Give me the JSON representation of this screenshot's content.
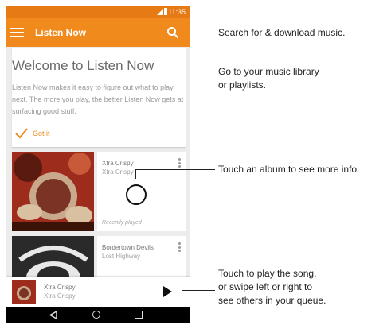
{
  "status_bar": {
    "time": "11:35"
  },
  "app_bar": {
    "title": "Listen Now",
    "menu_icon": "menu-icon",
    "search_icon": "search-icon"
  },
  "welcome_card": {
    "title": "Welcome to Listen Now",
    "body": "Listen Now makes it easy to figure out what to play next. The more you play, the better Listen Now gets at surfacing good stuff.",
    "got_it_label": "Got it",
    "got_it_icon": "check-icon"
  },
  "albums": [
    {
      "title": "Xtra Crispy",
      "artist": "Xtra Crispy",
      "note": "Recently played"
    },
    {
      "title": "Bordertown Devils",
      "artist": "Lost Highway",
      "note": ""
    }
  ],
  "now_playing": {
    "title": "Xtra Crispy",
    "artist": "Xtra Crispy",
    "play_icon": "play-icon"
  },
  "nav_bar": {
    "icons": [
      "back-icon",
      "home-icon",
      "recent-apps-icon"
    ]
  },
  "callouts": [
    "Search for & download music.",
    "Go to your music library\nor playlists.",
    "Touch an album to see more info.",
    "Touch to play the song,\nor swipe left or right to\nsee others in your queue."
  ],
  "colors": {
    "status_bar": "#e67a14",
    "app_bar": "#f08a1c",
    "accent": "#f08a1c"
  }
}
